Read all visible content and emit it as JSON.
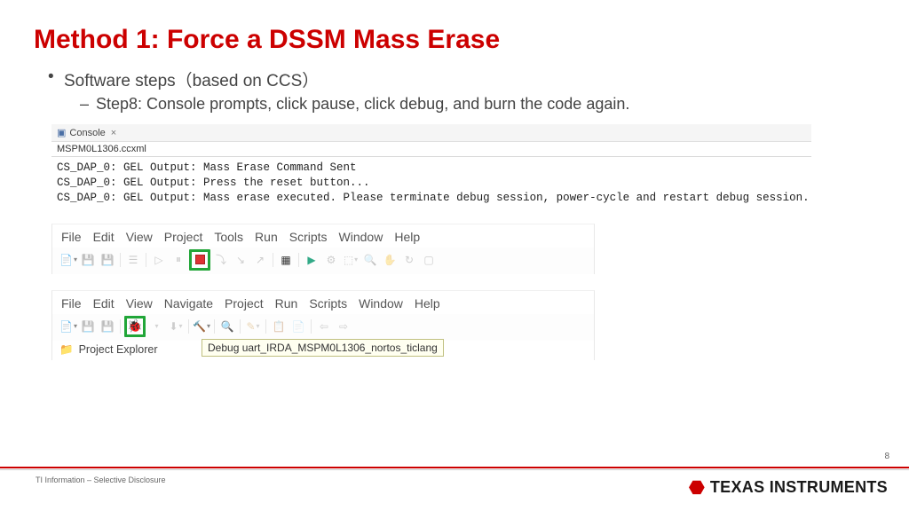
{
  "title": "Method 1: Force a DSSM Mass Erase",
  "bullet1": "Software steps（based on CCS）",
  "bullet2": "Step8: Console prompts, click pause, click debug, and burn the code again.",
  "console": {
    "tab_label": "Console",
    "file": "MSPM0L1306.ccxml",
    "lines": [
      "CS_DAP_0: GEL Output: Mass Erase Command Sent",
      "CS_DAP_0: GEL Output: Press the reset button...",
      "CS_DAP_0: GEL Output: Mass erase executed. Please terminate debug session, power-cycle and restart debug session."
    ]
  },
  "ide1": {
    "menus": [
      "File",
      "Edit",
      "View",
      "Project",
      "Tools",
      "Run",
      "Scripts",
      "Window",
      "Help"
    ]
  },
  "ide2": {
    "menus": [
      "File",
      "Edit",
      "View",
      "Navigate",
      "Project",
      "Run",
      "Scripts",
      "Window",
      "Help"
    ],
    "project_explorer": "Project Explorer",
    "tooltip": "Debug uart_IRDA_MSPM0L1306_nortos_ticlang"
  },
  "footer": {
    "page": "8",
    "left": "TI Information – Selective Disclosure",
    "brand": "TEXAS INSTRUMENTS"
  }
}
